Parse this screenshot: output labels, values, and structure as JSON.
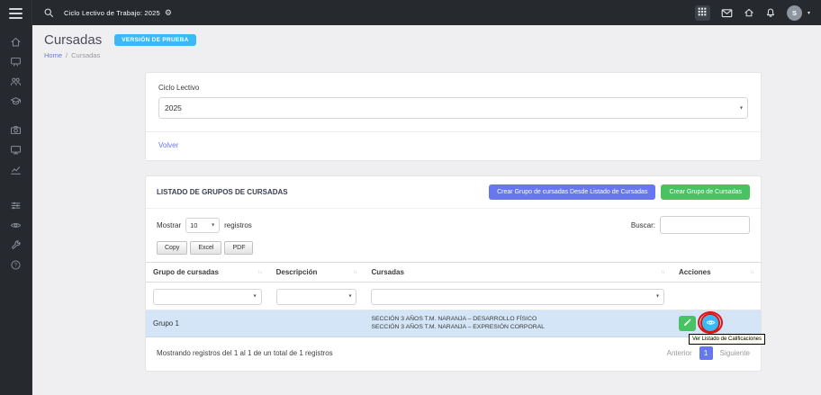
{
  "colors": {
    "primary": "#6777ef",
    "info": "#3abaf4",
    "success": "#47c363",
    "row_highlight": "#d3e5f6",
    "annotation": "#dd1414",
    "topbar_bg": "#26292e"
  },
  "icons": {
    "sidebar": [
      "menu-icon",
      "home-icon",
      "presentation-board-icon",
      "users-icon",
      "graduation-cap-icon",
      "camera-icon",
      "monitor-icon",
      "chart-icon",
      "sliders-icon",
      "eye-icon",
      "tools-icon",
      "help-icon"
    ],
    "topbar": [
      "search-icon",
      "gear-icon",
      "apps-grid-icon",
      "mail-icon",
      "home-icon",
      "bell-icon",
      "chevron-down-icon"
    ],
    "table": [
      "sort-icon"
    ],
    "actions": [
      "pencil-icon",
      "eye-icon"
    ]
  },
  "topbar": {
    "title": "Ciclo Lectivo de Trabajo: 2025",
    "avatar_initial": "S"
  },
  "page": {
    "title": "Cursadas",
    "version_badge": "VERSIÓN DE PRUEBA",
    "breadcrumb": {
      "home": "Home",
      "separator": "/",
      "current": "Cursadas"
    }
  },
  "ciclo_card": {
    "label": "Ciclo Lectivo",
    "selected_year": "2025",
    "back_link": "Volver"
  },
  "grupos": {
    "title": "LISTADO DE GRUPOS DE CURSADAS",
    "create_from_list_button": "Crear Grupo de cursadas Desde Listado de Cursadas",
    "create_button": "Crear Grupo de Cursadas",
    "length": {
      "prefix": "Mostrar",
      "value": "10",
      "suffix": "registros"
    },
    "search_label": "Buscar:",
    "export": {
      "copy": "Copy",
      "excel": "Excel",
      "pdf": "PDF"
    },
    "columns": {
      "grupo": "Grupo de cursadas",
      "descripcion": "Descripción",
      "cursadas": "Cursadas",
      "acciones": "Acciones"
    },
    "rows": [
      {
        "grupo": "Grupo 1",
        "descripcion": "",
        "cursadas_line1": "SECCIÓN 3 AÑOS T.M. NARANJA – DESARROLLO FÍSICO",
        "cursadas_line2": "SECCIÓN 3 AÑOS T.M. NARANJA – EXPRESIÓN CORPORAL"
      }
    ],
    "tooltip": "Ver Listado de Calificaciones",
    "footer_info": "Mostrando registros del 1 al 1 de un total de 1 registros",
    "pagination": {
      "previous": "Anterior",
      "page": "1",
      "next": "Siguiente"
    }
  }
}
